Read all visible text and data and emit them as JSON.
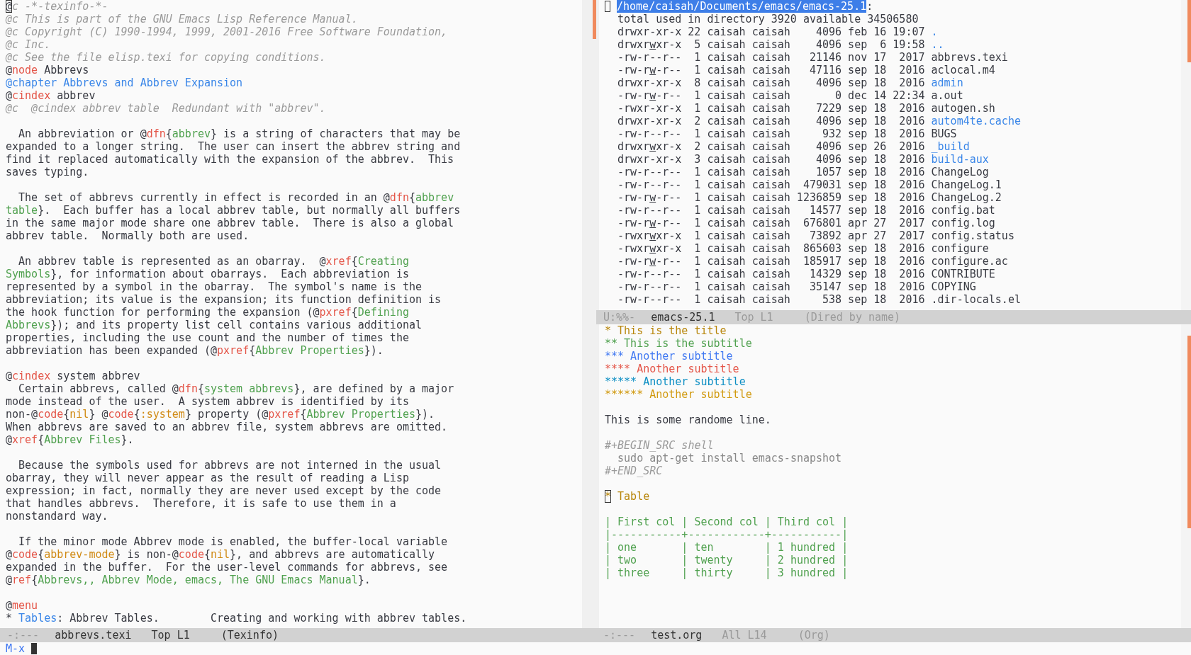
{
  "left_window": {
    "lines": [
      {
        "kind": "text",
        "segs": [
          {
            "kind": "cursor",
            "text": "@"
          },
          {
            "kind": "comment",
            "text": "c -*-texinfo-*-"
          }
        ]
      },
      {
        "kind": "text",
        "segs": [
          {
            "kind": "comment",
            "text": "@c This is part of the GNU Emacs Lisp Reference Manual."
          }
        ]
      },
      {
        "kind": "text",
        "segs": [
          {
            "kind": "comment",
            "text": "@c Copyright (C) 1990-1994, 1999, 2001-2016 Free Software Foundation,"
          }
        ]
      },
      {
        "kind": "text",
        "segs": [
          {
            "kind": "comment",
            "text": "@c Inc."
          }
        ]
      },
      {
        "kind": "text",
        "segs": [
          {
            "kind": "comment",
            "text": "@c See the file elisp.texi for copying conditions."
          }
        ]
      },
      {
        "kind": "text",
        "segs": [
          {
            "kind": "plain",
            "text": "@"
          },
          {
            "kind": "keyword",
            "text": "node"
          },
          {
            "kind": "plain",
            "text": " Abbrevs"
          }
        ]
      },
      {
        "kind": "text",
        "segs": [
          {
            "kind": "chapter",
            "text": "@chapter Abbrevs and Abbrev Expansion"
          }
        ]
      },
      {
        "kind": "text",
        "segs": [
          {
            "kind": "plain",
            "text": "@"
          },
          {
            "kind": "keyword",
            "text": "cindex"
          },
          {
            "kind": "plain",
            "text": " abbrev"
          }
        ]
      },
      {
        "kind": "text",
        "segs": [
          {
            "kind": "comment",
            "text": "@c  @cindex abbrev table  Redundant with \"abbrev\"."
          }
        ]
      },
      {
        "kind": "blank"
      },
      {
        "kind": "text",
        "segs": [
          {
            "kind": "plain",
            "text": "  An abbreviation or @"
          },
          {
            "kind": "keyword",
            "text": "dfn"
          },
          {
            "kind": "plain",
            "text": "{"
          },
          {
            "kind": "arg",
            "text": "abbrev"
          },
          {
            "kind": "plain",
            "text": "} is a string of characters that may be"
          }
        ]
      },
      {
        "kind": "text",
        "segs": [
          {
            "kind": "plain",
            "text": "expanded to a longer string.  The user can insert the abbrev string and"
          }
        ]
      },
      {
        "kind": "text",
        "segs": [
          {
            "kind": "plain",
            "text": "find it replaced automatically with the expansion of the abbrev.  This"
          }
        ]
      },
      {
        "kind": "text",
        "segs": [
          {
            "kind": "plain",
            "text": "saves typing."
          }
        ]
      },
      {
        "kind": "blank"
      },
      {
        "kind": "text",
        "segs": [
          {
            "kind": "plain",
            "text": "  The set of abbrevs currently in effect is recorded in an @"
          },
          {
            "kind": "keyword",
            "text": "dfn"
          },
          {
            "kind": "plain",
            "text": "{"
          },
          {
            "kind": "arg",
            "text": "abbrev"
          }
        ]
      },
      {
        "kind": "text",
        "segs": [
          {
            "kind": "arg",
            "text": "table"
          },
          {
            "kind": "plain",
            "text": "}.  Each buffer has a local abbrev table, but normally all buffers"
          }
        ]
      },
      {
        "kind": "text",
        "segs": [
          {
            "kind": "plain",
            "text": "in the same major mode share one abbrev table.  There is also a global"
          }
        ]
      },
      {
        "kind": "text",
        "segs": [
          {
            "kind": "plain",
            "text": "abbrev table.  Normally both are used."
          }
        ]
      },
      {
        "kind": "blank"
      },
      {
        "kind": "text",
        "segs": [
          {
            "kind": "plain",
            "text": "  An abbrev table is represented as an obarray.  @"
          },
          {
            "kind": "keyword",
            "text": "xref"
          },
          {
            "kind": "plain",
            "text": "{"
          },
          {
            "kind": "arg",
            "text": "Creating"
          }
        ]
      },
      {
        "kind": "text",
        "segs": [
          {
            "kind": "arg",
            "text": "Symbols"
          },
          {
            "kind": "plain",
            "text": "}, for information about obarrays.  Each abbreviation is"
          }
        ]
      },
      {
        "kind": "text",
        "segs": [
          {
            "kind": "plain",
            "text": "represented by a symbol in the obarray.  The symbol's name is the"
          }
        ]
      },
      {
        "kind": "text",
        "segs": [
          {
            "kind": "plain",
            "text": "abbreviation; its value is the expansion; its function definition is"
          }
        ]
      },
      {
        "kind": "text",
        "segs": [
          {
            "kind": "plain",
            "text": "the hook function for performing the expansion (@"
          },
          {
            "kind": "keyword",
            "text": "pxref"
          },
          {
            "kind": "plain",
            "text": "{"
          },
          {
            "kind": "arg",
            "text": "Defining"
          }
        ]
      },
      {
        "kind": "text",
        "segs": [
          {
            "kind": "arg",
            "text": "Abbrevs"
          },
          {
            "kind": "plain",
            "text": "}); and its property list cell contains various additional"
          }
        ]
      },
      {
        "kind": "text",
        "segs": [
          {
            "kind": "plain",
            "text": "properties, including the use count and the number of times the"
          }
        ]
      },
      {
        "kind": "text",
        "segs": [
          {
            "kind": "plain",
            "text": "abbreviation has been expanded (@"
          },
          {
            "kind": "keyword",
            "text": "pxref"
          },
          {
            "kind": "plain",
            "text": "{"
          },
          {
            "kind": "arg",
            "text": "Abbrev Properties"
          },
          {
            "kind": "plain",
            "text": "})."
          }
        ]
      },
      {
        "kind": "blank"
      },
      {
        "kind": "text",
        "segs": [
          {
            "kind": "plain",
            "text": "@"
          },
          {
            "kind": "keyword",
            "text": "cindex"
          },
          {
            "kind": "plain",
            "text": " system abbrev"
          }
        ]
      },
      {
        "kind": "text",
        "segs": [
          {
            "kind": "plain",
            "text": "  Certain abbrevs, called @"
          },
          {
            "kind": "keyword",
            "text": "dfn"
          },
          {
            "kind": "plain",
            "text": "{"
          },
          {
            "kind": "arg",
            "text": "system abbrevs"
          },
          {
            "kind": "plain",
            "text": "}, are defined by a major"
          }
        ]
      },
      {
        "kind": "text",
        "segs": [
          {
            "kind": "plain",
            "text": "mode instead of the user.  A system abbrev is identified by its"
          }
        ]
      },
      {
        "kind": "text",
        "segs": [
          {
            "kind": "plain",
            "text": "non-@"
          },
          {
            "kind": "keyword",
            "text": "code"
          },
          {
            "kind": "plain",
            "text": "{"
          },
          {
            "kind": "code",
            "text": "nil"
          },
          {
            "kind": "plain",
            "text": "} @"
          },
          {
            "kind": "keyword",
            "text": "code"
          },
          {
            "kind": "plain",
            "text": "{"
          },
          {
            "kind": "code",
            "text": ":system"
          },
          {
            "kind": "plain",
            "text": "} property (@"
          },
          {
            "kind": "keyword",
            "text": "pxref"
          },
          {
            "kind": "plain",
            "text": "{"
          },
          {
            "kind": "arg",
            "text": "Abbrev Properties"
          },
          {
            "kind": "plain",
            "text": "})."
          }
        ]
      },
      {
        "kind": "text",
        "segs": [
          {
            "kind": "plain",
            "text": "When abbrevs are saved to an abbrev file, system abbrevs are omitted."
          }
        ]
      },
      {
        "kind": "text",
        "segs": [
          {
            "kind": "plain",
            "text": "@"
          },
          {
            "kind": "keyword",
            "text": "xref"
          },
          {
            "kind": "plain",
            "text": "{"
          },
          {
            "kind": "arg",
            "text": "Abbrev Files"
          },
          {
            "kind": "plain",
            "text": "}."
          }
        ]
      },
      {
        "kind": "blank"
      },
      {
        "kind": "text",
        "segs": [
          {
            "kind": "plain",
            "text": "  Because the symbols used for abbrevs are not interned in the usual"
          }
        ]
      },
      {
        "kind": "text",
        "segs": [
          {
            "kind": "plain",
            "text": "obarray, they will never appear as the result of reading a Lisp"
          }
        ]
      },
      {
        "kind": "text",
        "segs": [
          {
            "kind": "plain",
            "text": "expression; in fact, normally they are never used except by the code"
          }
        ]
      },
      {
        "kind": "text",
        "segs": [
          {
            "kind": "plain",
            "text": "that handles abbrevs.  Therefore, it is safe to use them in a"
          }
        ]
      },
      {
        "kind": "text",
        "segs": [
          {
            "kind": "plain",
            "text": "nonstandard way."
          }
        ]
      },
      {
        "kind": "blank"
      },
      {
        "kind": "text",
        "segs": [
          {
            "kind": "plain",
            "text": "  If the minor mode Abbrev mode is enabled, the buffer-local variable"
          }
        ]
      },
      {
        "kind": "text",
        "segs": [
          {
            "kind": "plain",
            "text": "@"
          },
          {
            "kind": "keyword",
            "text": "code"
          },
          {
            "kind": "plain",
            "text": "{"
          },
          {
            "kind": "code",
            "text": "abbrev-mode"
          },
          {
            "kind": "plain",
            "text": "} is non-@"
          },
          {
            "kind": "keyword",
            "text": "code"
          },
          {
            "kind": "plain",
            "text": "{"
          },
          {
            "kind": "code",
            "text": "nil"
          },
          {
            "kind": "plain",
            "text": "}, and abbrevs are automatically"
          }
        ]
      },
      {
        "kind": "text",
        "segs": [
          {
            "kind": "plain",
            "text": "expanded in the buffer.  For the user-level commands for abbrevs, see"
          }
        ]
      },
      {
        "kind": "text",
        "segs": [
          {
            "kind": "plain",
            "text": "@"
          },
          {
            "kind": "keyword",
            "text": "ref"
          },
          {
            "kind": "plain",
            "text": "{"
          },
          {
            "kind": "arg",
            "text": "Abbrevs,, Abbrev Mode, emacs, The GNU Emacs Manual"
          },
          {
            "kind": "plain",
            "text": "}."
          }
        ]
      },
      {
        "kind": "blank"
      },
      {
        "kind": "text",
        "segs": [
          {
            "kind": "plain",
            "text": "@"
          },
          {
            "kind": "keyword",
            "text": "menu"
          }
        ]
      },
      {
        "kind": "text",
        "segs": [
          {
            "kind": "plain",
            "text": "* "
          },
          {
            "kind": "link",
            "text": "Tables"
          },
          {
            "kind": "plain",
            "text": ": Abbrev Tables.        Creating and working with abbrev tables."
          }
        ]
      }
    ],
    "mode_line": {
      "active": true,
      "status": "-:---",
      "buffer": "abbrevs.texi",
      "position": "Top L1",
      "mode": "(Texinfo)"
    }
  },
  "dired_window": {
    "header": {
      "cursor": true,
      "path": "/home/caisah/Documents/emacs/emacs-25.1",
      "suffix": ":"
    },
    "summary": "total used in directory 3920 available 34506580",
    "rows": [
      {
        "perms": "drwxr-xr-x",
        "group_write": false,
        "info": "22 caisah caisah    4096 feb 16 19:07",
        "name": ".",
        "directory": true
      },
      {
        "perms": "drwxrwxr-x",
        "group_write": true,
        "info": " 5 caisah caisah    4096 sep  6 19:58",
        "name": "..",
        "directory": true
      },
      {
        "perms": "-rw-r--r--",
        "group_write": false,
        "info": " 1 caisah caisah   21146 nov 17  2017",
        "name": "abbrevs.texi",
        "directory": false
      },
      {
        "perms": "-rw-rw-r--",
        "group_write": true,
        "info": " 1 caisah caisah   47116 sep 18  2016",
        "name": "aclocal.m4",
        "directory": false
      },
      {
        "perms": "drwxr-xr-x",
        "group_write": false,
        "info": " 8 caisah caisah    4096 sep 18  2016",
        "name": "admin",
        "directory": true
      },
      {
        "perms": "-rw-rw-r--",
        "group_write": true,
        "info": " 1 caisah caisah       0 dec 14 22:34",
        "name": "a.out",
        "directory": false
      },
      {
        "perms": "-rwxr-xr-x",
        "group_write": false,
        "info": " 1 caisah caisah    7229 sep 18  2016",
        "name": "autogen.sh",
        "directory": false
      },
      {
        "perms": "drwxr-xr-x",
        "group_write": false,
        "info": " 2 caisah caisah    4096 sep 18  2016",
        "name": "autom4te.cache",
        "directory": true
      },
      {
        "perms": "-rw-r--r--",
        "group_write": false,
        "info": " 1 caisah caisah     932 sep 18  2016",
        "name": "BUGS",
        "directory": false
      },
      {
        "perms": "drwxrwxr-x",
        "group_write": true,
        "info": " 2 caisah caisah    4096 sep 26  2016",
        "name": "_build",
        "directory": true
      },
      {
        "perms": "drwxr-xr-x",
        "group_write": false,
        "info": " 3 caisah caisah    4096 sep 18  2016",
        "name": "build-aux",
        "directory": true
      },
      {
        "perms": "-rw-r--r--",
        "group_write": false,
        "info": " 1 caisah caisah    1057 sep 18  2016",
        "name": "ChangeLog",
        "directory": false
      },
      {
        "perms": "-rw-r--r--",
        "group_write": false,
        "info": " 1 caisah caisah  479031 sep 18  2016",
        "name": "ChangeLog.1",
        "directory": false
      },
      {
        "perms": "-rw-rw-r--",
        "group_write": true,
        "info": " 1 caisah caisah 1236859 sep 18  2016",
        "name": "ChangeLog.2",
        "directory": false
      },
      {
        "perms": "-rw-r--r--",
        "group_write": false,
        "info": " 1 caisah caisah   14577 sep 18  2016",
        "name": "config.bat",
        "directory": false
      },
      {
        "perms": "-rw-rw-r--",
        "group_write": true,
        "info": " 1 caisah caisah  676801 apr 27  2017",
        "name": "config.log",
        "directory": false
      },
      {
        "perms": "-rwxrwxr-x",
        "group_write": true,
        "info": " 1 caisah caisah   73892 apr 27  2017",
        "name": "config.status",
        "directory": false
      },
      {
        "perms": "-rwxrwxr-x",
        "group_write": true,
        "info": " 1 caisah caisah  865603 sep 18  2016",
        "name": "configure",
        "directory": false
      },
      {
        "perms": "-rw-rw-r--",
        "group_write": true,
        "info": " 1 caisah caisah  185917 sep 18  2016",
        "name": "configure.ac",
        "directory": false
      },
      {
        "perms": "-rw-r--r--",
        "group_write": false,
        "info": " 1 caisah caisah   14329 sep 18  2016",
        "name": "CONTRIBUTE",
        "directory": false
      },
      {
        "perms": "-rw-r--r--",
        "group_write": false,
        "info": " 1 caisah caisah   35147 sep 18  2016",
        "name": "COPYING",
        "directory": false
      },
      {
        "perms": "-rw-r--r--",
        "group_write": false,
        "info": " 1 caisah caisah     538 sep 18  2016",
        "name": ".dir-locals.el",
        "directory": false
      }
    ],
    "mode_line": {
      "active": false,
      "status": "U:%%-",
      "buffer": "emacs-25.1",
      "position": "Top L1",
      "mode": "(Dired by name)"
    }
  },
  "org_window": {
    "lines": [
      {
        "kind": "text",
        "segs": [
          {
            "kind": "org1",
            "text": "* This is the title"
          }
        ]
      },
      {
        "kind": "text",
        "segs": [
          {
            "kind": "org2",
            "text": "** This is the subtitle"
          }
        ]
      },
      {
        "kind": "text",
        "segs": [
          {
            "kind": "org3",
            "text": "*** Another subtitle"
          }
        ]
      },
      {
        "kind": "text",
        "segs": [
          {
            "kind": "org4",
            "text": "**** Another subtitle"
          }
        ]
      },
      {
        "kind": "text",
        "segs": [
          {
            "kind": "org5",
            "text": "***** Another subtitle"
          }
        ]
      },
      {
        "kind": "text",
        "segs": [
          {
            "kind": "org6",
            "text": "****** Another subtitle"
          }
        ]
      },
      {
        "kind": "blank"
      },
      {
        "kind": "text",
        "segs": [
          {
            "kind": "plain",
            "text": "This is some randome line."
          }
        ]
      },
      {
        "kind": "blank"
      },
      {
        "kind": "text",
        "segs": [
          {
            "kind": "meta",
            "text": "#+BEGIN_SRC shell"
          }
        ]
      },
      {
        "kind": "text",
        "segs": [
          {
            "kind": "src",
            "text": "  sudo apt-get install emacs-snapshot"
          }
        ]
      },
      {
        "kind": "text",
        "segs": [
          {
            "kind": "meta",
            "text": "#+END_SRC"
          }
        ]
      },
      {
        "kind": "blank"
      },
      {
        "kind": "text",
        "segs": [
          {
            "kind": "cursor_org1",
            "text": "*"
          },
          {
            "kind": "org1",
            "text": " Table"
          }
        ]
      },
      {
        "kind": "blank"
      },
      {
        "kind": "text",
        "segs": [
          {
            "kind": "table",
            "text": "| First col | Second col | Third col |"
          }
        ]
      },
      {
        "kind": "text",
        "segs": [
          {
            "kind": "table",
            "text": "|-----------+------------+-----------|"
          }
        ]
      },
      {
        "kind": "text",
        "segs": [
          {
            "kind": "table",
            "text": "| one       | ten        | 1 hundred |"
          }
        ]
      },
      {
        "kind": "text",
        "segs": [
          {
            "kind": "table",
            "text": "| two       | twenty     | 2 hundred |"
          }
        ]
      },
      {
        "kind": "text",
        "segs": [
          {
            "kind": "table",
            "text": "| three     | thirty     | 3 hundred |"
          }
        ]
      }
    ],
    "mode_line": {
      "active": false,
      "status": "-:---",
      "buffer": "test.org",
      "position": "All L14",
      "mode": "(Org)"
    }
  },
  "minibuffer": {
    "prompt": "M-x",
    "cursor": true
  }
}
